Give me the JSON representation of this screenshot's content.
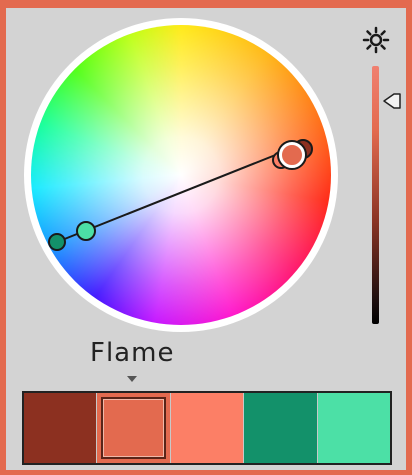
{
  "palette": {
    "name": "Flame",
    "selected_index": 1,
    "swatches": [
      {
        "color": "#8c3020"
      },
      {
        "color": "#e36a4f"
      },
      {
        "color": "#fc7f66"
      },
      {
        "color": "#13916a"
      },
      {
        "color": "#4ce0a6"
      }
    ]
  },
  "colors": {
    "frame": "#e36a4f",
    "panel": "#d3d3d3"
  },
  "icons": {
    "brightness": "sun-icon",
    "slider_thumb": "triangle-left-icon"
  }
}
